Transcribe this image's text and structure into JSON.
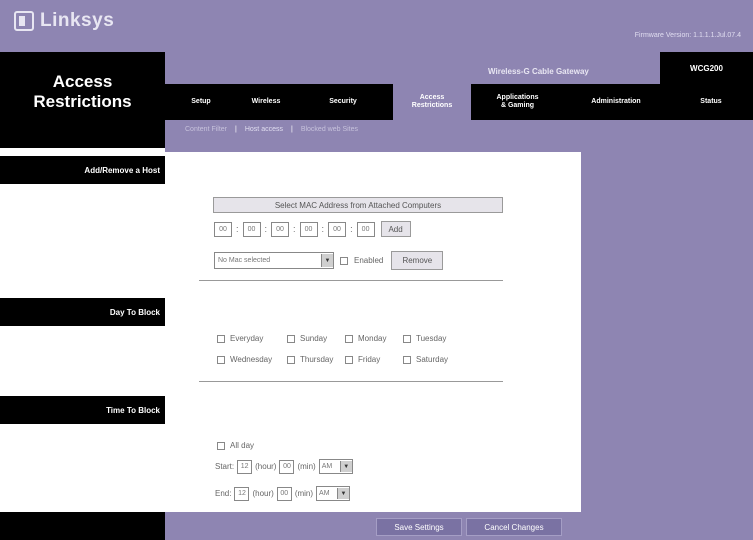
{
  "brand": {
    "logo_text": "Linksys",
    "firmware": "Firmware Version: 1.1.1.1.Jul.07.4"
  },
  "header": {
    "section_title_line1": "Access",
    "section_title_line2": "Restrictions",
    "product_name": "Wireless-G Cable Gateway",
    "model": "WCG200"
  },
  "nav": {
    "setup": "Setup",
    "wireless": "Wireless",
    "security": "Security",
    "access_line1": "Access",
    "access_line2": "Restrictions",
    "apps_line1": "Applications",
    "apps_line2": "& Gaming",
    "administration": "Administration",
    "status": "Status"
  },
  "subtabs": {
    "content_filter": "Content Filter",
    "sep1": "|",
    "host_access": "Host access",
    "sep2": "|",
    "blocked_keywords": "Blocked web Sites"
  },
  "sections": {
    "add_remove": "Add/Remove a Host",
    "day_to_block": "Day To Block",
    "time_to_block": "Time To Block"
  },
  "add_host": {
    "select_button": "Select MAC Address from Attached Computers",
    "mac_fields": [
      "00",
      "00",
      "00",
      "00",
      "00",
      "00"
    ],
    "add_button": "Add",
    "host_select": "No Mac selected",
    "enabled_label": "Enabled",
    "remove_button": "Remove"
  },
  "days": {
    "everyday": "Everyday",
    "sunday": "Sunday",
    "monday": "Monday",
    "tuesday": "Tuesday",
    "wednesday": "Wednesday",
    "thursday": "Thursday",
    "friday": "Friday",
    "saturday": "Saturday"
  },
  "time": {
    "all_day": "All day",
    "start_label": "Start:",
    "end_label": "End:",
    "hour_label": "(hour)",
    "min_label": "(min)",
    "start_hour": "12",
    "start_min": "00",
    "start_ampm": "AM",
    "end_hour": "12",
    "end_min": "00",
    "end_ampm": "AM"
  },
  "footer": {
    "save": "Save Settings",
    "cancel": "Cancel Changes"
  },
  "colors": {
    "accent": "#8e85b2",
    "black": "#000000"
  }
}
